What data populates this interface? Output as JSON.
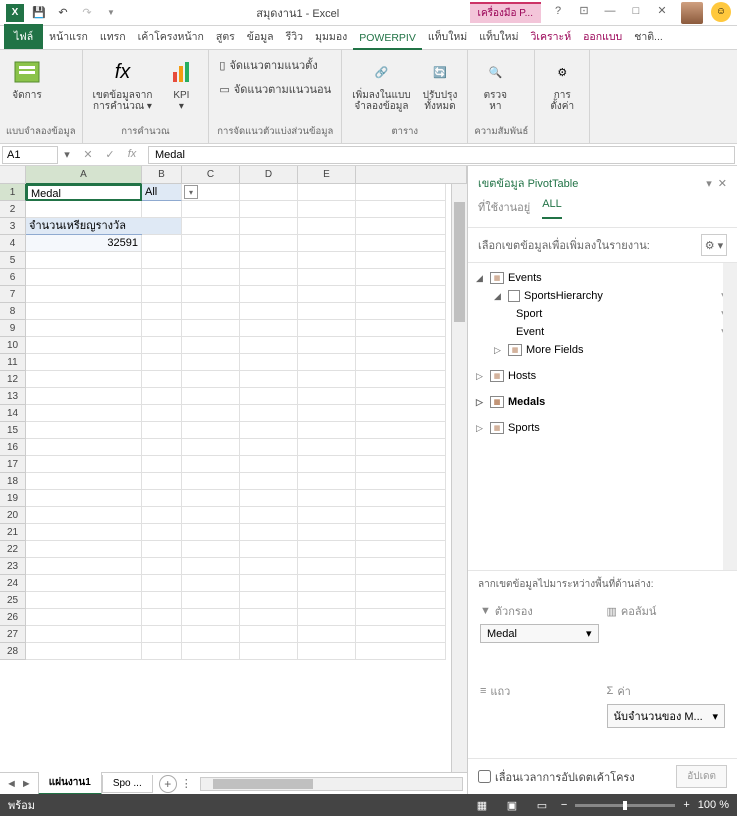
{
  "titlebar": {
    "title": "สมุดงาน1 - Excel",
    "context_title": "เครื่องมือ P..."
  },
  "tabs": {
    "file": "ไฟล์",
    "list": [
      "หน้าแรก",
      "แทรก",
      "เค้าโครงหน้าก",
      "สูตร",
      "ข้อมูล",
      "รีวิว",
      "มุมมอง"
    ],
    "active": "POWERPIV",
    "after": [
      "แท็บใหม่",
      "แท็บใหม่"
    ],
    "context": [
      "วิเคราะห์",
      "ออกแบบ",
      "ชาติ..."
    ]
  },
  "ribbon": {
    "g1_btn": "จัดการ",
    "g1_label": "แบบจำลองข้อมูล",
    "g2_btn1": "เขตข้อมูลจาก\nการคำนวณ ▾",
    "g2_btn2": "KPI\n▾",
    "g2_label": "การคำนวณ",
    "g3_r1": "จัดแนวตามแนวตั้ง",
    "g3_r2": "จัดแนวตามแนวนอน",
    "g3_label": "การจัดแนวตัวแบ่งส่วนข้อมูล",
    "g4_b1": "เพิ่มลงในแบบ\nจำลองข้อมูล",
    "g4_b2": "ปรับปรุง\nทั้งหมด",
    "g4_label": "ตาราง",
    "g5_b": "ตรวจ\nหา",
    "g5_label": "ความสัมพันธ์",
    "g6_b": "การ\nตั้งค่า"
  },
  "formula": {
    "namebox": "A1",
    "fx": "Medal"
  },
  "cols": [
    "A",
    "B",
    "C",
    "D",
    "E"
  ],
  "cells": {
    "A1": "Medal",
    "B1": "All",
    "A3": "จำนวนเหรียญรางวัล",
    "A4": "32591"
  },
  "sheet_tabs": {
    "t1": "แผ่นงาน1",
    "t2": "Spo ..."
  },
  "pivot": {
    "title": "เขตข้อมูล PivotTable",
    "sub1": "ที่ใช้งานอยู่",
    "sub2": "ALL",
    "search": "เลือกเขตข้อมูลเพื่อเพิ่มลงในรายงาน:",
    "f_events": "Events",
    "f_sportsh": "SportsHierarchy",
    "f_sport": "Sport",
    "f_event": "Event",
    "f_more": "More Fields",
    "f_hosts": "Hosts",
    "f_medals": "Medals",
    "f_sports": "Sports",
    "drag": "ลากเขตข้อมูลไปมาระหว่างพื้นที่ด้านล่าง:",
    "a_filter": "ตัวกรอง",
    "a_cols": "คอลัมน์",
    "a_rows": "แถว",
    "a_vals": "ค่า",
    "v_filter": "Medal",
    "v_val": "นับจำนวนของ M...",
    "defer": "เลื่อนเวลาการอัปเดตเค้าโครง",
    "update": "อัปเดต"
  },
  "status": {
    "ready": "พร้อม",
    "zoom": "100 %"
  }
}
